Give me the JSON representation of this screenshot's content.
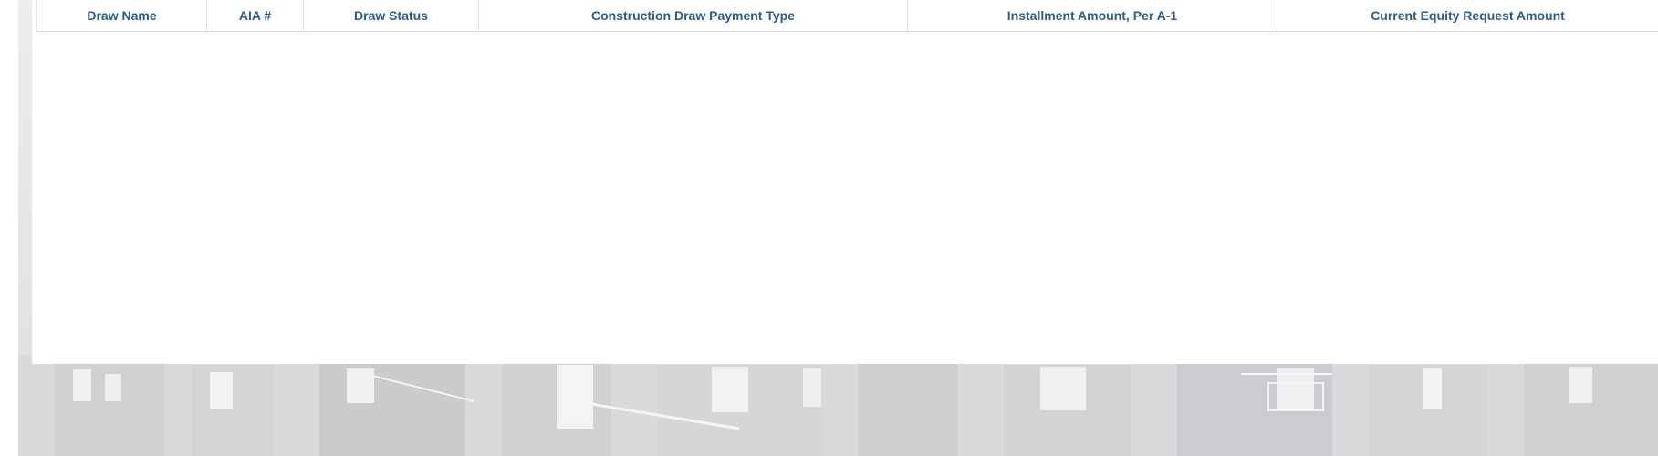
{
  "table": {
    "columns": [
      {
        "label": "Draw Name"
      },
      {
        "label": "AIA #"
      },
      {
        "label": "Draw Status"
      },
      {
        "label": "Construction Draw Payment Type"
      },
      {
        "label": "Installment Amount, Per A-1"
      },
      {
        "label": "Current Equity Request Amount"
      }
    ],
    "rows": []
  },
  "colors": {
    "header_text": "#2e5b86",
    "border": "#e3e4e6"
  }
}
